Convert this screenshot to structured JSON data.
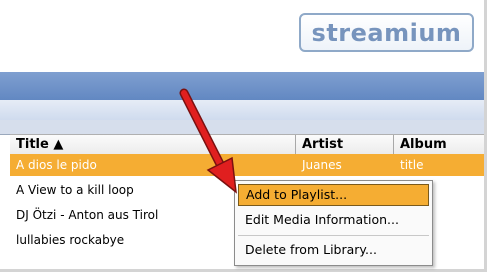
{
  "app": {
    "logo_text": "streamium"
  },
  "columns": {
    "title": "Title ▲",
    "artist": "Artist",
    "album": "Album"
  },
  "rows": [
    {
      "title": "A dios le pido",
      "artist": "Juanes",
      "album": "title",
      "selected": true
    },
    {
      "title": "A View to a kill loop",
      "artist": "",
      "album": ""
    },
    {
      "title": "DJ Ötzi - Anton aus Tirol",
      "artist": "",
      "album": ""
    },
    {
      "title": "lullabies rockabye",
      "artist": "",
      "album": ""
    }
  ],
  "context_menu": {
    "add_to_playlist": "Add to Playlist...",
    "edit_media_info": "Edit Media Information...",
    "delete_from_library": "Delete from Library..."
  },
  "colors": {
    "selection": "#f5ad33",
    "header_blue": "#6d93c9",
    "arrow": "#e01f1f"
  },
  "icons": {
    "annotation_arrow": "red-arrow-icon"
  }
}
